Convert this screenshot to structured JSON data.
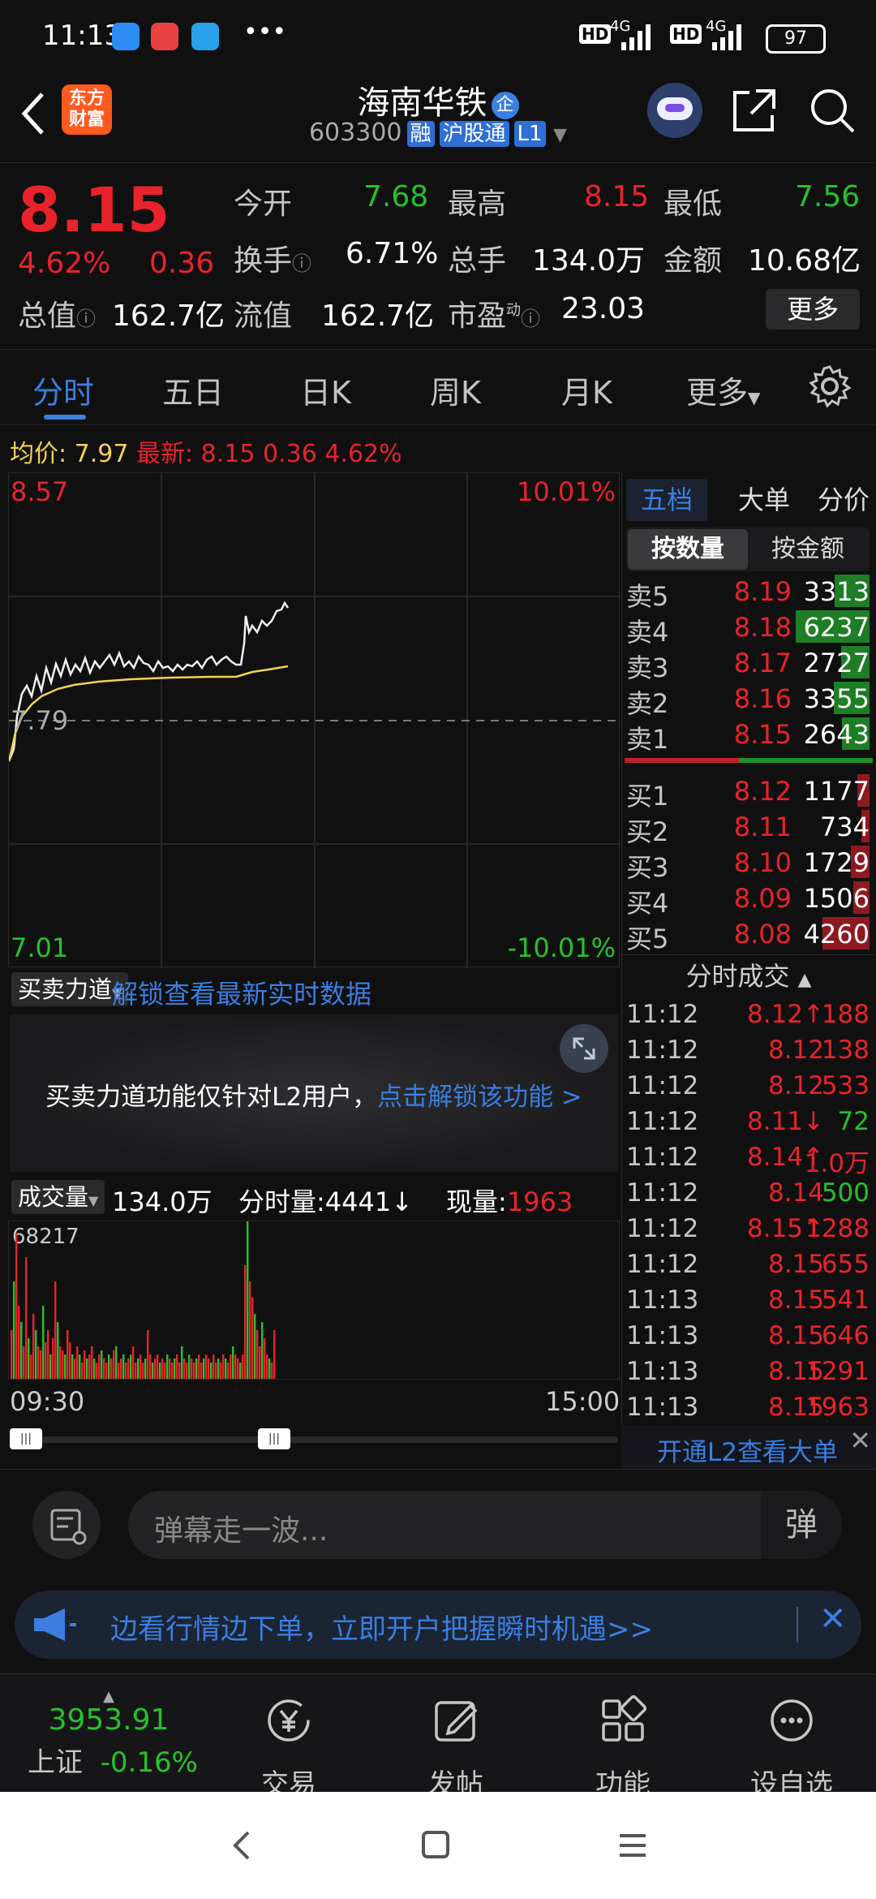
{
  "status": {
    "time": "11:13",
    "dots": "•••",
    "net1": "HD",
    "sig1": "4G",
    "net2": "HD",
    "sig2": "4G",
    "battery": "97"
  },
  "header": {
    "logo_line1": "东方",
    "logo_line2": "财富",
    "stock_name": "海南华铁",
    "badge_enterprise": "企",
    "code": "603300",
    "tag_margin": "融",
    "tag_connect": "沪股通",
    "tag_level": "L1"
  },
  "quote": {
    "price": "8.15",
    "pct": "4.62%",
    "change": "0.36",
    "open_label": "今开",
    "open": "7.68",
    "high_label": "最高",
    "high": "8.15",
    "low_label": "最低",
    "low": "7.56",
    "turnover_label": "换手",
    "turnover": "6.71%",
    "volume_label": "总手",
    "volume": "134.0万",
    "amount_label": "金额",
    "amount": "10.68亿",
    "mktcap_label": "总值",
    "mktcap": "162.7亿",
    "float_label": "流值",
    "float": "162.7亿",
    "pe_label": "市盈",
    "pe_sup": "动",
    "pe": "23.03",
    "more": "更多"
  },
  "tabs": [
    "分时",
    "五日",
    "日K",
    "周K",
    "月K",
    "更多"
  ],
  "avg_bar": {
    "avg_label": "均价:",
    "avg": "7.97",
    "latest_label": "最新:",
    "latest": "8.15",
    "chg": "0.36",
    "pct": "4.62%"
  },
  "chart": {
    "y_top": "8.57",
    "y_mid": "7.79",
    "y_bottom": "7.01",
    "pct_top": "10.01%",
    "pct_bottom": "-10.01%"
  },
  "book": {
    "tabs": [
      "五档",
      "大单",
      "分价"
    ],
    "mode_tabs": [
      "按数量",
      "按金额"
    ],
    "asks": [
      {
        "label": "卖5",
        "price": "8.19",
        "vol": "3313",
        "fill": 0.45
      },
      {
        "label": "卖4",
        "price": "8.18",
        "vol": "6237",
        "fill": 0.95
      },
      {
        "label": "卖3",
        "price": "8.17",
        "vol": "2727",
        "fill": 0.36
      },
      {
        "label": "卖2",
        "price": "8.16",
        "vol": "3355",
        "fill": 0.46
      },
      {
        "label": "卖1",
        "price": "8.15",
        "vol": "2643",
        "fill": 0.35
      }
    ],
    "bids": [
      {
        "label": "买1",
        "price": "8.12",
        "vol": "1177",
        "fill": 0.16
      },
      {
        "label": "买2",
        "price": "8.11",
        "vol": "734",
        "fill": 0.1
      },
      {
        "label": "买3",
        "price": "8.10",
        "vol": "1729",
        "fill": 0.24
      },
      {
        "label": "买4",
        "price": "8.09",
        "vol": "1506",
        "fill": 0.21
      },
      {
        "label": "买5",
        "price": "8.08",
        "vol": "4260",
        "fill": 0.6
      }
    ]
  },
  "ticks": {
    "title": "分时成交",
    "rows": [
      {
        "time": "11:12",
        "price": "8.12↑",
        "vol": "188",
        "pc": "red",
        "vc": "red"
      },
      {
        "time": "11:12",
        "price": "8.12",
        "vol": "138",
        "pc": "red",
        "vc": "red"
      },
      {
        "time": "11:12",
        "price": "8.12",
        "vol": "533",
        "pc": "red",
        "vc": "red"
      },
      {
        "time": "11:12",
        "price": "8.11↓",
        "vol": "72",
        "pc": "red",
        "vc": "green"
      },
      {
        "time": "11:12",
        "price": "8.14↑",
        "vol": "1.0万",
        "pc": "red",
        "vc": "red"
      },
      {
        "time": "11:12",
        "price": "8.14",
        "vol": "500",
        "pc": "red",
        "vc": "green"
      },
      {
        "time": "11:12",
        "price": "8.15↑",
        "vol": "1288",
        "pc": "red",
        "vc": "red"
      },
      {
        "time": "11:12",
        "price": "8.15",
        "vol": "655",
        "pc": "red",
        "vc": "red"
      },
      {
        "time": "11:13",
        "price": "8.15",
        "vol": "541",
        "pc": "red",
        "vc": "red"
      },
      {
        "time": "11:13",
        "price": "8.15",
        "vol": "646",
        "pc": "red",
        "vc": "red"
      },
      {
        "time": "11:13",
        "price": "8.15",
        "vol": "1291",
        "pc": "red",
        "vc": "red"
      },
      {
        "time": "11:13",
        "price": "8.15",
        "vol": "1963",
        "pc": "red",
        "vc": "red"
      }
    ],
    "l2_link": "开通L2查看大单"
  },
  "force": {
    "select": "买卖力道",
    "unlock_link": "解锁查看最新实时数据",
    "msg": "买卖力道功能仅针对L2用户，",
    "msg_link": "点击解锁该功能 >"
  },
  "volume": {
    "select": "成交量",
    "total": "134.0万",
    "period_label": "分时量:4441",
    "current_label": "现量:",
    "current": "1963",
    "max": "68217",
    "time_start": "09:30",
    "time_end": "15:00"
  },
  "comment": {
    "placeholder": "弹幕走一波...",
    "danmu_btn": "弹"
  },
  "promo": {
    "text": "边看行情边下单，立即开户把握瞬时机遇>>"
  },
  "nav": {
    "index_value": "3953.91",
    "index_name": "上证",
    "index_pct": "-0.16%",
    "items": [
      "交易",
      "发帖",
      "功能",
      "设自选"
    ]
  }
}
